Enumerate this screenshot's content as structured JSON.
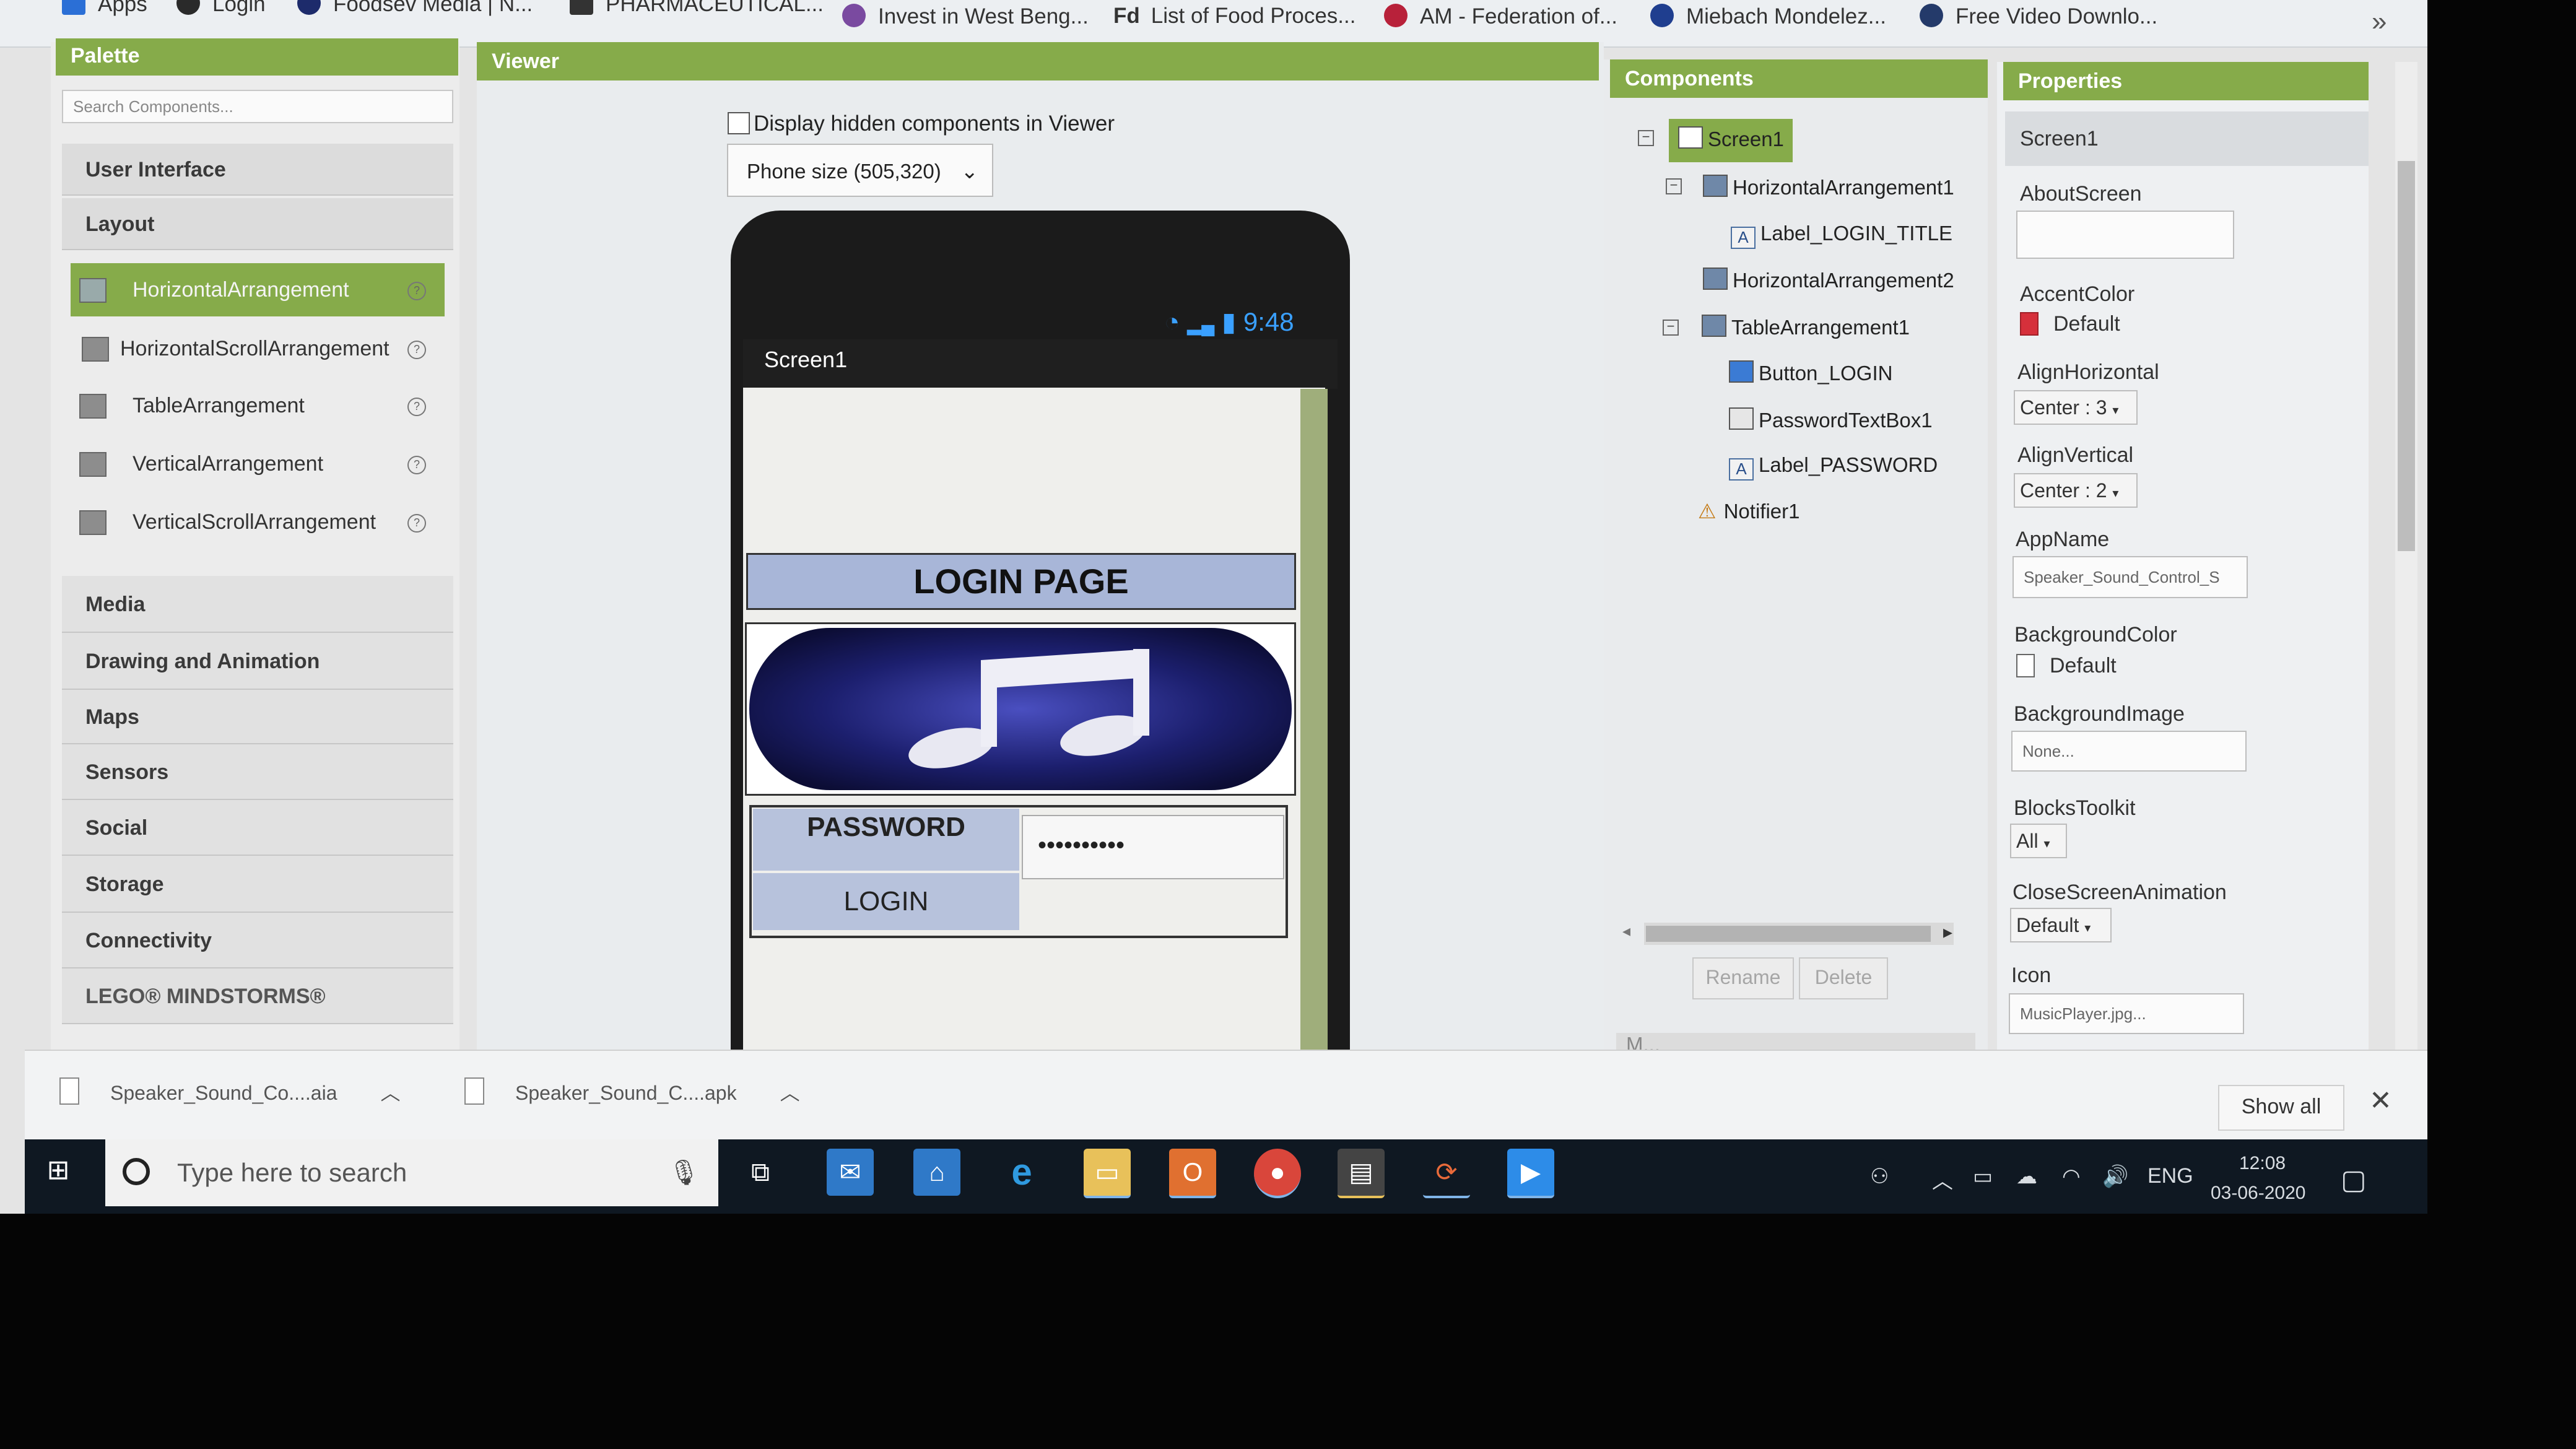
{
  "bookmarks": [
    "Apps",
    "Login",
    "Foodsev Media | N...",
    "PHARMACEUTICAL...",
    "Invest in West Beng...",
    "List of Food Proces...",
    "AM - Federation of...",
    "Miebach Mondelez...",
    "Free Video Downlo..."
  ],
  "bookmark_prefix_fd": "Fd",
  "palette": {
    "title": "Palette",
    "search_placeholder": "Search Components...",
    "categories": [
      "User Interface",
      "Layout",
      "Media",
      "Drawing and Animation",
      "Maps",
      "Sensors",
      "Social",
      "Storage",
      "Connectivity",
      "LEGO® MINDSTORMS®"
    ],
    "layout_items": [
      "HorizontalArrangement",
      "HorizontalScrollArrangement",
      "TableArrangement",
      "VerticalArrangement",
      "VerticalScrollArrangement"
    ]
  },
  "viewer": {
    "title": "Viewer",
    "checkbox_label": "Display hidden components in Viewer",
    "phone_size": "Phone size (505,320)",
    "status_time": "9:48",
    "screen_title": "Screen1",
    "login_title": "LOGIN PAGE",
    "password_label": "PASSWORD",
    "password_value": "••••••••••",
    "login_button": "LOGIN"
  },
  "components": {
    "title": "Components",
    "tree": [
      "Screen1",
      "HorizontalArrangement1",
      "Label_LOGIN_TITLE",
      "HorizontalArrangement2",
      "TableArrangement1",
      "Button_LOGIN",
      "PasswordTextBox1",
      "Label_PASSWORD",
      "Notifier1"
    ],
    "rename": "Rename",
    "delete": "Delete",
    "media_partial": "M..."
  },
  "properties": {
    "title": "Properties",
    "selected": "Screen1",
    "about_label": "AboutScreen",
    "accent_label": "AccentColor",
    "accent_value": "Default",
    "align_h_label": "AlignHorizontal",
    "align_h_value": "Center : 3",
    "align_v_label": "AlignVertical",
    "align_v_value": "Center : 2",
    "appname_label": "AppName",
    "appname_value": "Speaker_Sound_Control_S",
    "bgcolor_label": "BackgroundColor",
    "bgcolor_value": "Default",
    "bgimage_label": "BackgroundImage",
    "bgimage_value": "None...",
    "blocks_label": "BlocksToolkit",
    "blocks_value": "All",
    "close_anim_label": "CloseScreenAnimation",
    "close_anim_value": "Default",
    "icon_label": "Icon",
    "icon_value": "MusicPlayer.jpg..."
  },
  "downloads": {
    "file1": "Speaker_Sound_Co....aia",
    "file2": "Speaker_Sound_C....apk",
    "show_all": "Show all"
  },
  "taskbar": {
    "search_placeholder": "Type here to search",
    "language": "ENG",
    "time": "12:08",
    "date": "03-06-2020"
  },
  "colors": {
    "header_green": "#86ab4a",
    "accent_red": "#d6303b",
    "status_blue": "#3aa0ff"
  }
}
